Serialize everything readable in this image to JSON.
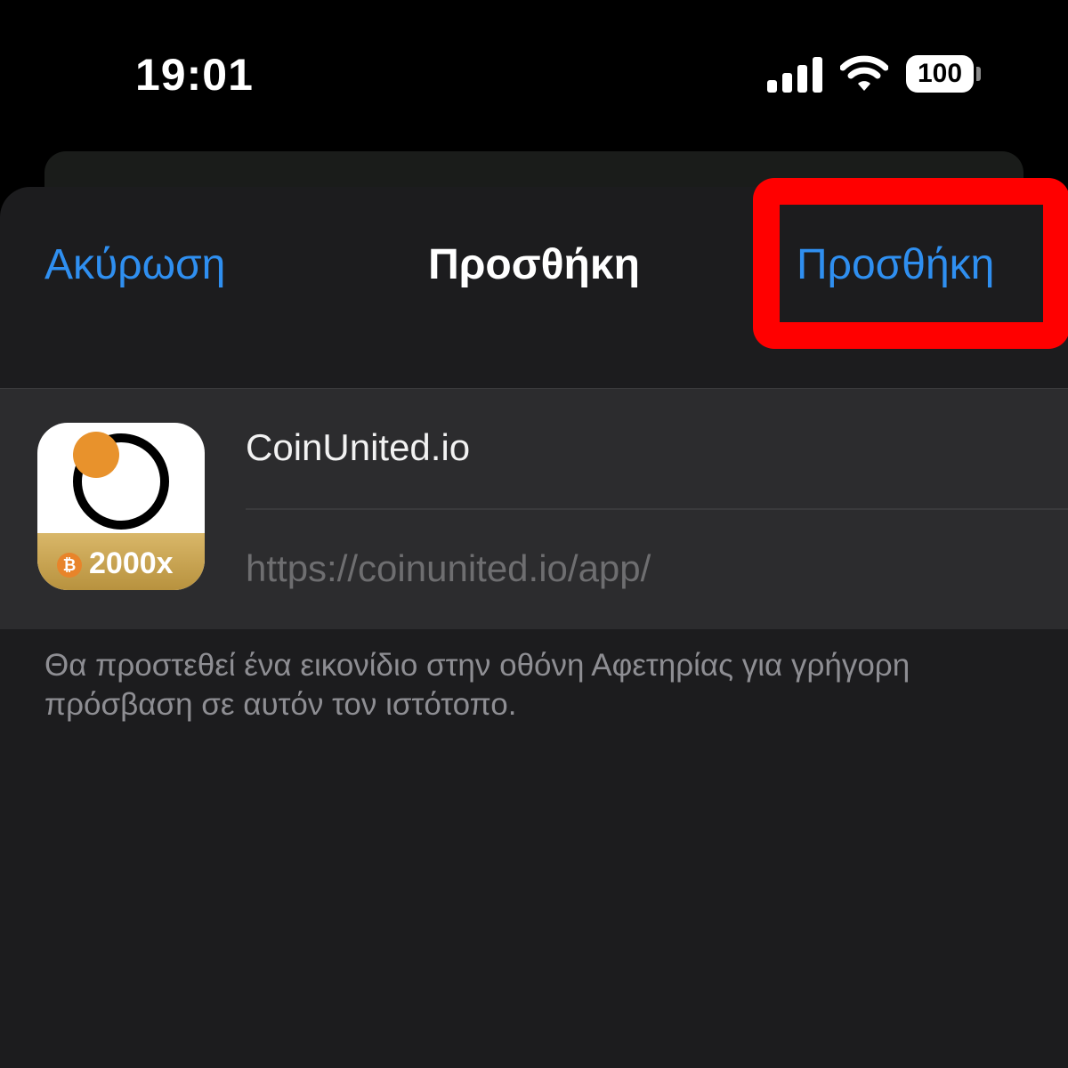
{
  "status_bar": {
    "time": "19:01",
    "battery_level": "100",
    "signal_icon": "cellular-signal-icon",
    "wifi_icon": "wifi-icon"
  },
  "nav": {
    "cancel_label": "Ακύρωση",
    "title": "Προσθήκη",
    "add_label": "Προσθήκη"
  },
  "app": {
    "icon_badge": "2000x",
    "name": "CoinUnited.io",
    "url": "https://coinunited.io/app/"
  },
  "hint": "Θα προστεθεί ένα εικονίδιο στην οθόνη Αφετηρίας για γρήγορη πρόσβαση σε αυτόν τον ιστότοπο.",
  "colors": {
    "accent": "#2f8ff0",
    "highlight": "#ff0000",
    "sheet": "#1c1c1e",
    "card": "#2c2c2e"
  }
}
